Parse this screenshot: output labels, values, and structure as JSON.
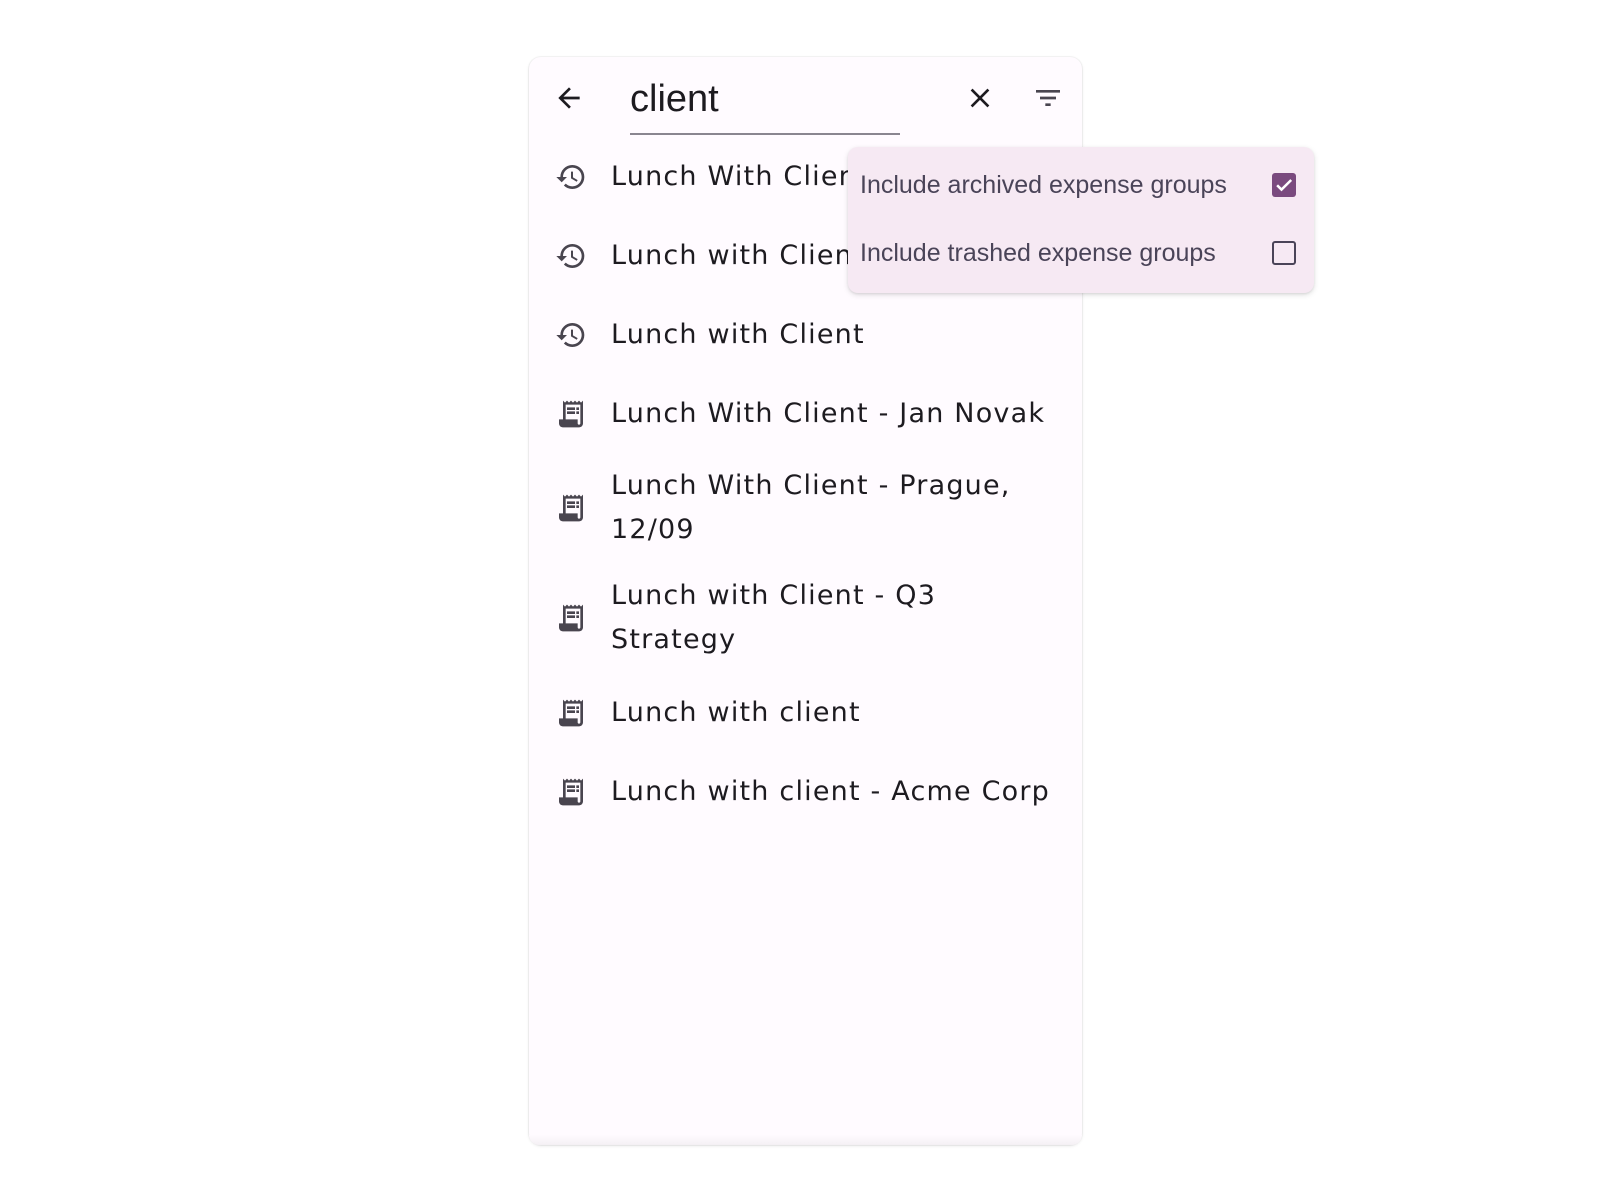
{
  "search": {
    "query": "client",
    "icons": {
      "back": "arrow-back-icon",
      "clear": "close-icon",
      "filter": "filter-list-icon"
    }
  },
  "results": [
    {
      "icon": "history-icon",
      "label": "Lunch With Client"
    },
    {
      "icon": "history-icon",
      "label": "Lunch with Client"
    },
    {
      "icon": "history-icon",
      "label": "Lunch with Client"
    },
    {
      "icon": "receipt-icon",
      "label": "Lunch With Client - Jan Novak"
    },
    {
      "icon": "receipt-icon",
      "label": "Lunch With Client - Prague, 12/09"
    },
    {
      "icon": "receipt-icon",
      "label": "Lunch with Client - Q3 Strategy"
    },
    {
      "icon": "receipt-icon",
      "label": "Lunch with client"
    },
    {
      "icon": "receipt-icon",
      "label": "Lunch with client - Acme Corp"
    }
  ],
  "filter_menu": {
    "items": [
      {
        "label": "Include archived expense groups",
        "checked": true
      },
      {
        "label": "Include trashed expense groups",
        "checked": false
      }
    ]
  },
  "colors": {
    "menu_background": "#f6e9f3",
    "checkbox_accent": "#7a4a7e",
    "text_primary": "#1d1b20",
    "icon": "#49454f"
  }
}
